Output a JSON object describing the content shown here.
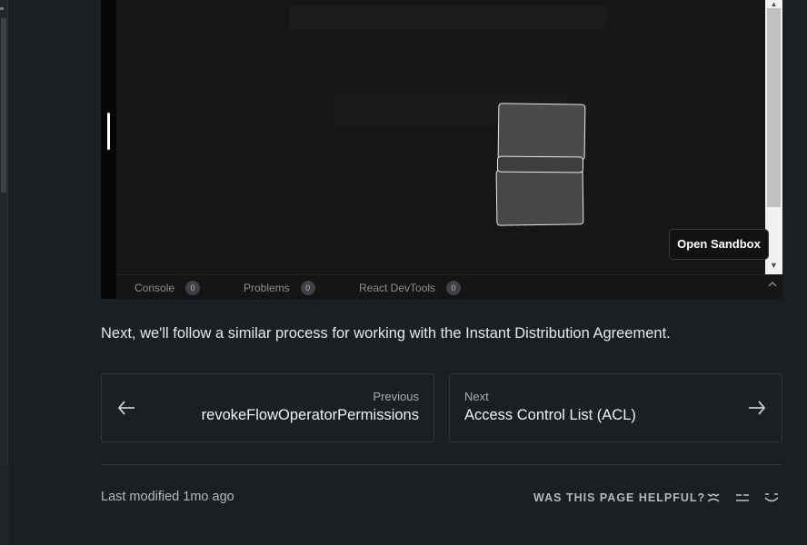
{
  "sandbox": {
    "open_button": "Open Sandbox",
    "devtools": {
      "tabs": [
        {
          "label": "Console",
          "count": "0"
        },
        {
          "label": "Problems",
          "count": "0"
        },
        {
          "label": "React DevTools",
          "count": "0"
        }
      ]
    }
  },
  "content": {
    "paragraph": "Next, we'll follow a similar process for working with the Instant Distribution Agreement."
  },
  "pager": {
    "previous": {
      "sub": "Previous",
      "title": "revokeFlowOperatorPermissions"
    },
    "next": {
      "sub": "Next",
      "title": "Access Control List (ACL)"
    }
  },
  "footer": {
    "last_modified": "Last modified 1mo ago",
    "helpful_label": "WAS THIS PAGE HELPFUL?",
    "feedback_icons": [
      "sad-face-icon",
      "neutral-face-icon",
      "happy-face-icon"
    ]
  }
}
